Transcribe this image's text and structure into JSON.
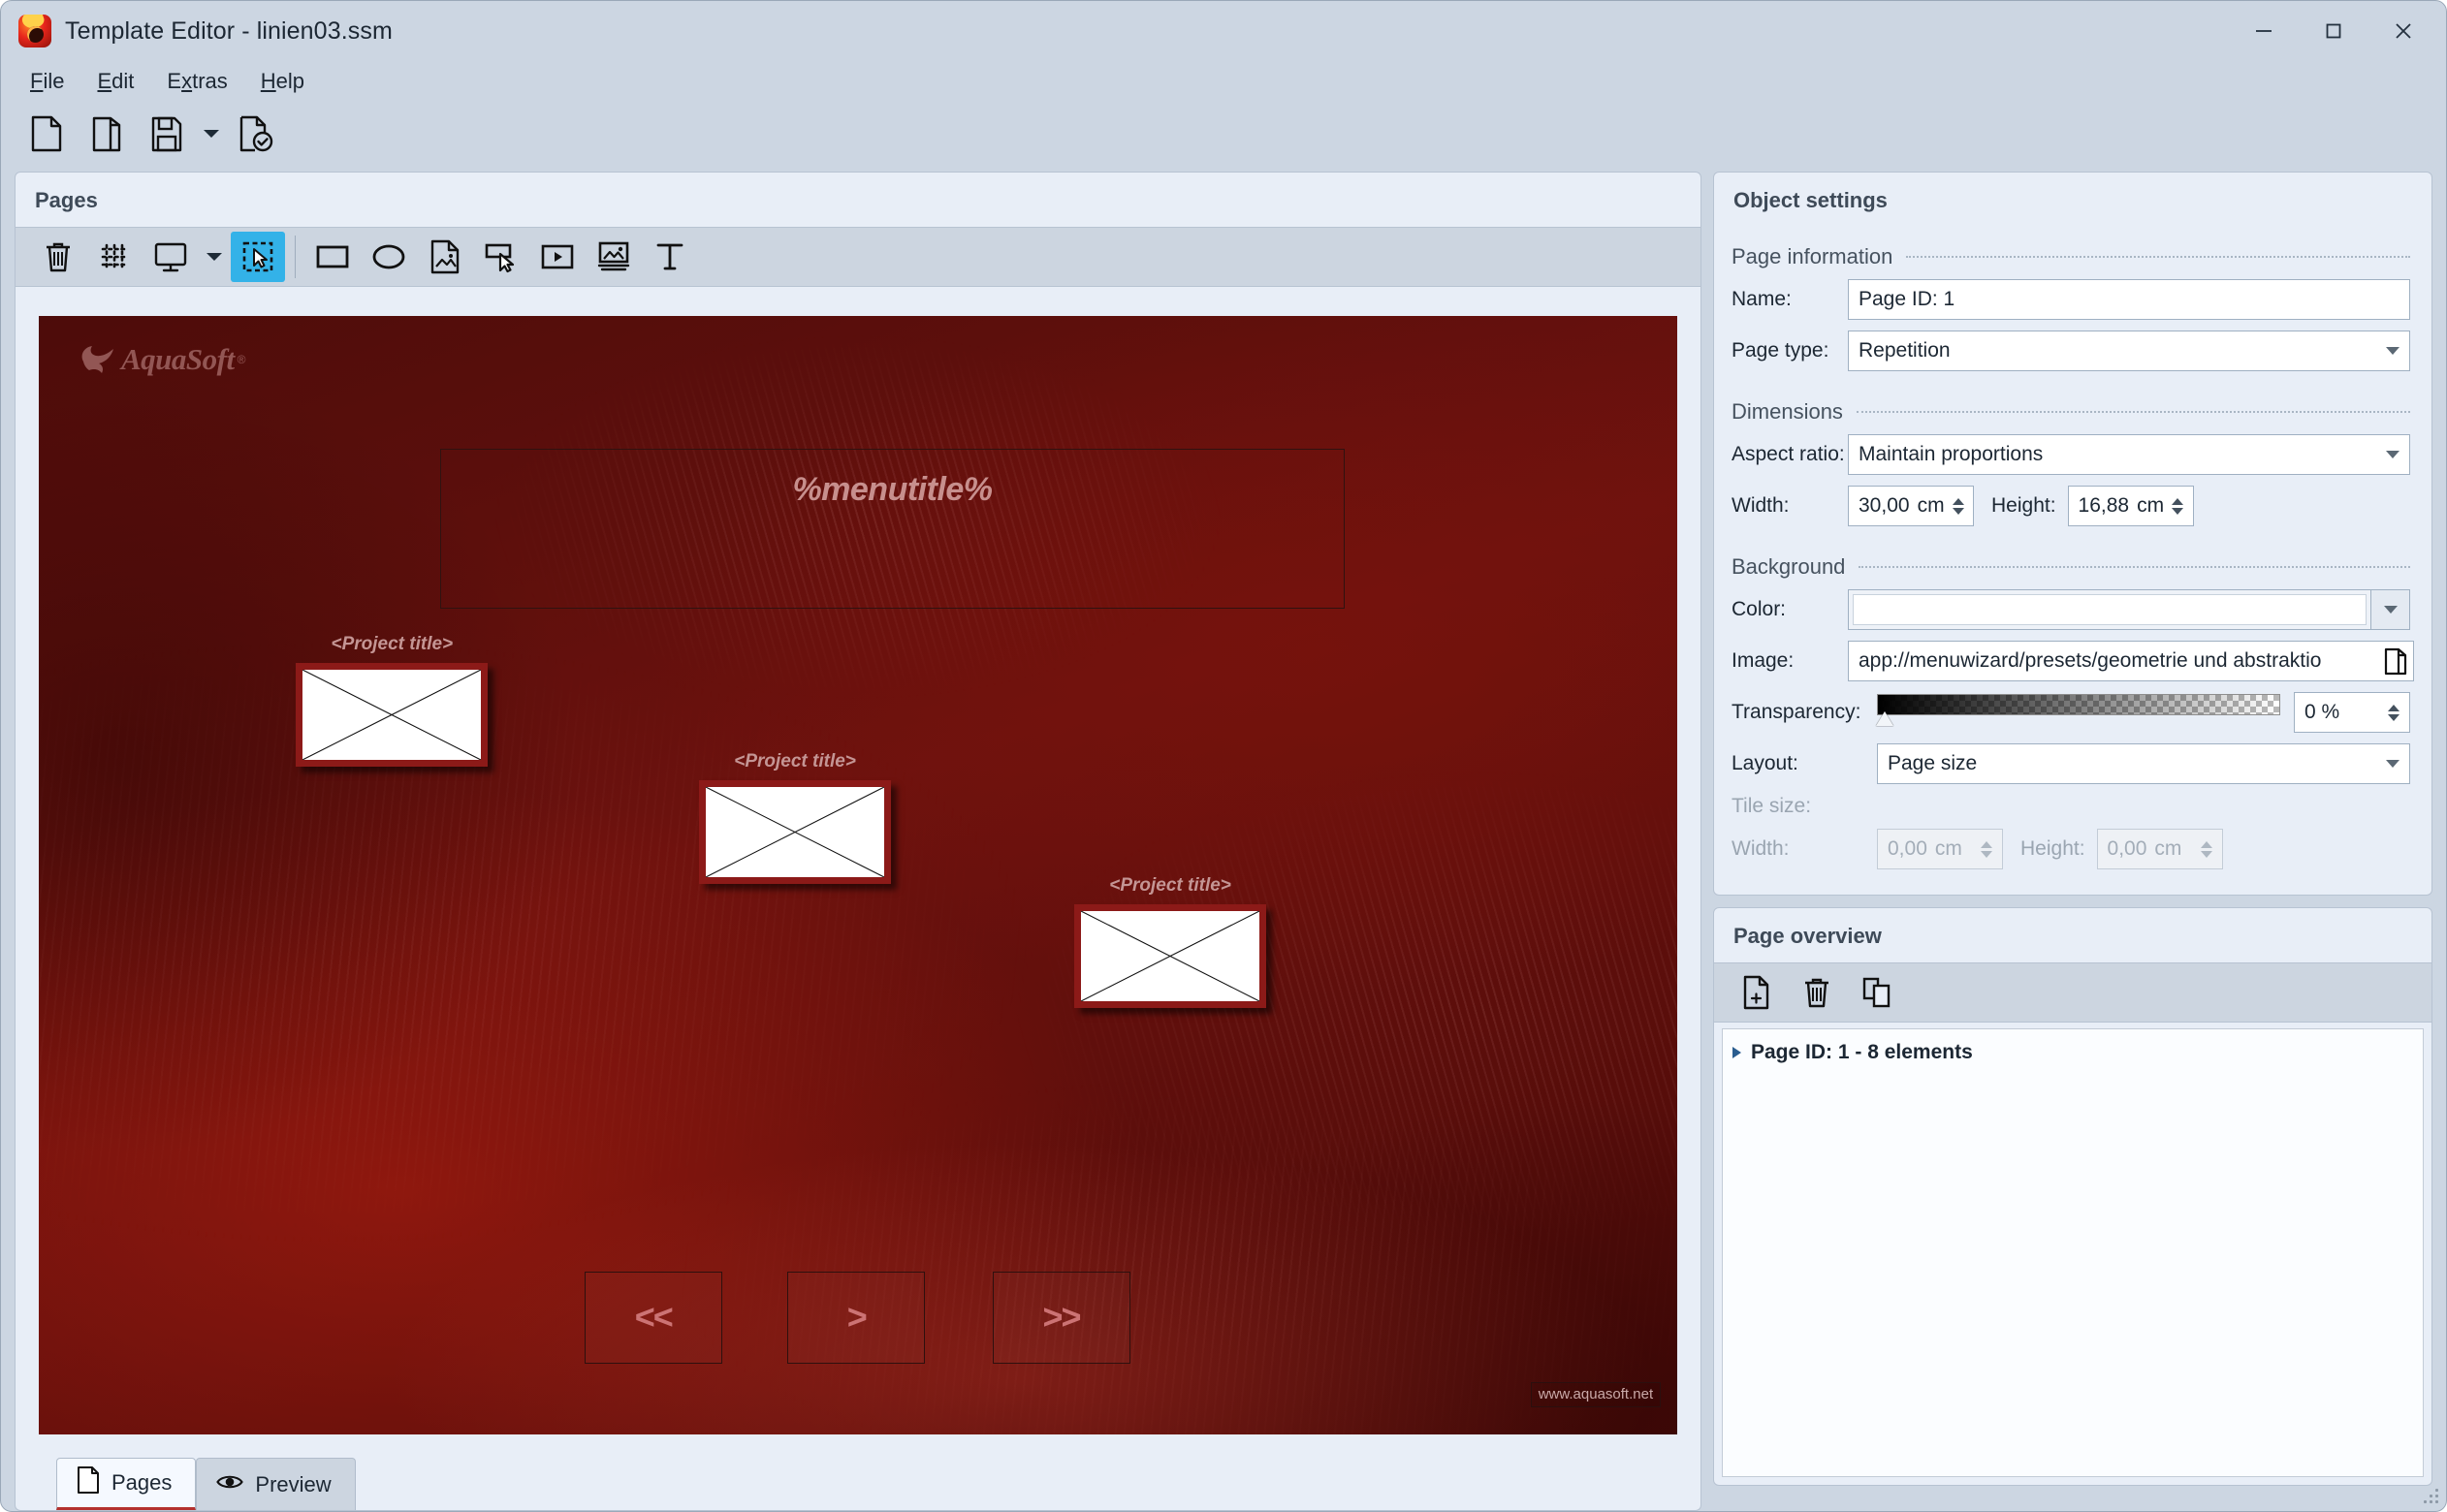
{
  "window": {
    "title": "Template Editor - linien03.ssm",
    "icon": "aquasoft-app-icon",
    "controls": {
      "minimize": "–",
      "maximize": "□",
      "close": "✕"
    }
  },
  "menubar": {
    "items": [
      {
        "label": "File",
        "accel": "F"
      },
      {
        "label": "Edit",
        "accel": "E"
      },
      {
        "label": "Extras",
        "accel": "x"
      },
      {
        "label": "Help",
        "accel": "H"
      }
    ]
  },
  "main_toolbar": {
    "buttons": [
      {
        "name": "new-document-icon",
        "tip": "New"
      },
      {
        "name": "open-folder-icon",
        "tip": "Open"
      },
      {
        "name": "save-icon",
        "tip": "Save"
      },
      {
        "name": "save-dropdown-caret-icon",
        "tip": "Save options"
      },
      {
        "name": "document-check-icon",
        "tip": "Validate"
      }
    ]
  },
  "pages_panel": {
    "title": "Pages",
    "toolbar": [
      {
        "name": "trash-icon",
        "tip": "Delete",
        "active": false
      },
      {
        "name": "grid-snap-icon",
        "tip": "Grid",
        "active": false
      },
      {
        "name": "monitor-icon",
        "tip": "Display",
        "active": false
      },
      {
        "name": "monitor-dropdown-caret-icon",
        "tip": "Display options",
        "active": false
      },
      {
        "name": "select-tool-icon",
        "tip": "Select",
        "active": true
      },
      {
        "name": "rectangle-tool-icon",
        "tip": "Rectangle",
        "active": false
      },
      {
        "name": "ellipse-tool-icon",
        "tip": "Ellipse",
        "active": false
      },
      {
        "name": "image-page-tool-icon",
        "tip": "Image page",
        "active": false
      },
      {
        "name": "button-tool-icon",
        "tip": "Button",
        "active": false
      },
      {
        "name": "video-tool-icon",
        "tip": "Video",
        "active": false
      },
      {
        "name": "image-tool-icon",
        "tip": "Image",
        "active": false
      },
      {
        "name": "text-tool-icon",
        "tip": "Text",
        "active": false
      }
    ]
  },
  "canvas": {
    "watermark_logo": {
      "word": "AquaSoft",
      "registered": "®"
    },
    "menu_title": "%menutitle%",
    "placeholders": [
      {
        "caption": "<Project title>"
      },
      {
        "caption": "<Project title>"
      },
      {
        "caption": "<Project title>"
      }
    ],
    "nav_buttons": [
      {
        "label": "<<",
        "name": "nav-first-button"
      },
      {
        "label": ">",
        "name": "nav-next-button"
      },
      {
        "label": ">>",
        "name": "nav-last-button"
      }
    ],
    "url_watermark": "www.aquasoft.net"
  },
  "bottom_tabs": [
    {
      "label": "Pages",
      "icon": "page-icon",
      "active": true
    },
    {
      "label": "Preview",
      "icon": "eye-icon",
      "active": false
    }
  ],
  "object_settings": {
    "title": "Object settings",
    "page_information": {
      "section_label": "Page information",
      "name_label": "Name:",
      "name_value": "Page ID: 1",
      "page_type_label": "Page type:",
      "page_type_value": "Repetition"
    },
    "dimensions": {
      "section_label": "Dimensions",
      "aspect_ratio_label": "Aspect ratio:",
      "aspect_ratio_value": "Maintain proportions",
      "width_label": "Width:",
      "width_value": "30,00",
      "width_unit": "cm",
      "height_label": "Height:",
      "height_value": "16,88",
      "height_unit": "cm"
    },
    "background": {
      "section_label": "Background",
      "color_label": "Color:",
      "color_value": "#ffffff",
      "image_label": "Image:",
      "image_value": "app://menuwizard/presets/geometrie und abstraktio",
      "browse_icon": "open-folder-icon",
      "transparency_label": "Transparency:",
      "transparency_value": "0 %",
      "layout_label": "Layout:",
      "layout_value": "Page size",
      "tile_size_label": "Tile size:",
      "tile_width_label": "Width:",
      "tile_width_value": "0,00",
      "tile_width_unit": "cm",
      "tile_height_label": "Height:",
      "tile_height_value": "0,00",
      "tile_height_unit": "cm"
    }
  },
  "page_overview": {
    "title": "Page overview",
    "toolbar": [
      {
        "name": "add-page-icon",
        "tip": "Add page"
      },
      {
        "name": "delete-page-icon",
        "tip": "Delete page"
      },
      {
        "name": "duplicate-page-icon",
        "tip": "Duplicate page"
      }
    ],
    "tree": [
      {
        "label": "Page ID: 1 - 8 elements",
        "expanded": false
      }
    ]
  },
  "colors": {
    "window_chrome": "#ccd6e2",
    "panel_bg": "#e8eef7",
    "toolbar_bg": "#ccd5e0",
    "accent_active": "#33b2e8",
    "tab_underline": "#b4312e",
    "canvas_red": "#5d0f0c",
    "placeholder_border": "#8c1a18",
    "canvas_text": "#c78f8d"
  }
}
